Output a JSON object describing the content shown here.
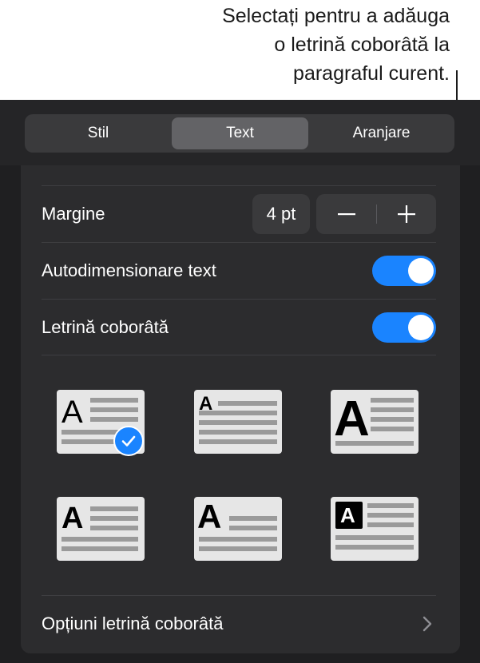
{
  "callout": {
    "lines": [
      "Selectați pentru a adăuga",
      "o letrină coborâtă la",
      "paragraful curent."
    ]
  },
  "tabs": [
    {
      "label": "Stil",
      "active": false
    },
    {
      "label": "Text",
      "active": true
    },
    {
      "label": "Aranjare",
      "active": false
    }
  ],
  "margin": {
    "label": "Margine",
    "value": "4 pt",
    "decrement_icon": "minus-icon",
    "increment_icon": "plus-icon"
  },
  "autosize": {
    "label": "Autodimensionare text",
    "on": true
  },
  "dropcap": {
    "label": "Letrină coborâtă",
    "on": true
  },
  "styles": {
    "letter": "A",
    "selected_index": 0,
    "count": 6
  },
  "options": {
    "label": "Opțiuni letrină coborâtă",
    "icon": "chevron-right-icon"
  },
  "colors": {
    "accent": "#1a84ff",
    "panel": "#2c2c2e",
    "control": "#3a3a3c"
  }
}
